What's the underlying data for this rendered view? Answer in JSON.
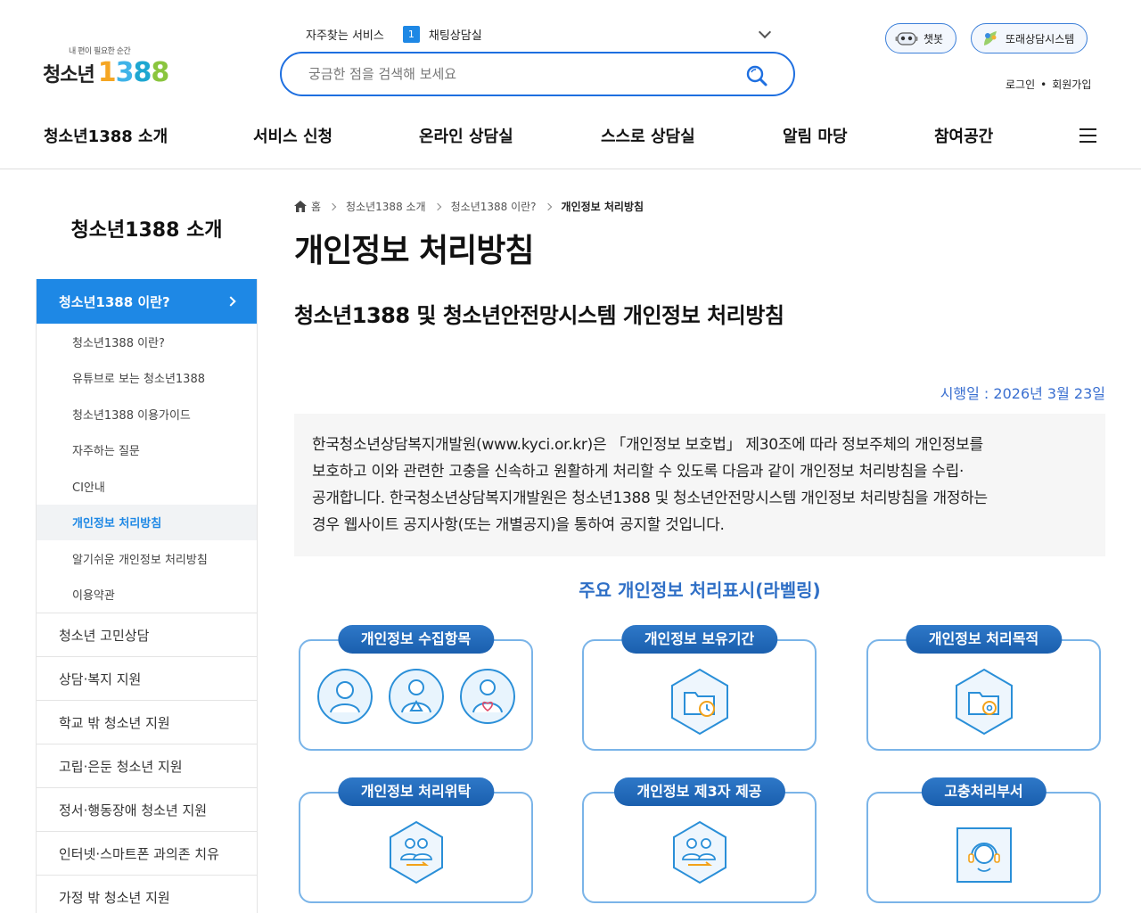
{
  "logo": {
    "tagline": "내 편이 필요한 순간",
    "name": "청소년",
    "number": [
      "1",
      "3",
      "8",
      "8"
    ]
  },
  "frequent": {
    "label": "자주찾는 서비스",
    "rank": "1",
    "item": "채팅상담실"
  },
  "search": {
    "placeholder": "궁금한 점을 검색해 보세요"
  },
  "top_buttons": {
    "chatbot": "챗봇",
    "peer": "또래상담시스템"
  },
  "account": {
    "login": "로그인",
    "sep": "•",
    "join": "회원가입"
  },
  "gnb": [
    "청소년1388 소개",
    "서비스 신청",
    "온라인 상담실",
    "스스로 상담실",
    "알림 마당",
    "참여공간"
  ],
  "sidebar": {
    "title": "청소년1388 소개",
    "active": "청소년1388 이란?",
    "sub_items": [
      "청소년1388 이란?",
      "유튜브로 보는 청소년1388",
      "청소년1388 이용가이드",
      "자주하는 질문",
      "CI안내",
      "개인정보 처리방침",
      "알기쉬운 개인정보 처리방침",
      "이용약관"
    ],
    "current_sub": "개인정보 처리방침",
    "items": [
      "청소년 고민상담",
      "상담·복지 지원",
      "학교 밖 청소년 지원",
      "고립·은둔 청소년 지원",
      "정서·행동장애 청소년 지원",
      "인터넷·스마트폰 과의존 치유",
      "가정 밖 청소년 지원"
    ]
  },
  "breadcrumb": [
    "홈",
    "청소년1388 소개",
    "청소년1388 이란?",
    "개인정보 처리방침"
  ],
  "page_title": "개인정보 처리방침",
  "subtitle": "청소년1388 및 청소년안전망시스템 개인정보 처리방침",
  "effective_date": "시행일 : 2026년 3월 23일",
  "intro_lines": [
    "한국청소년상담복지개발원(www.kyci.or.kr)은 「개인정보 보호법」 제30조에 따라 정보주체의 개인정보를",
    "보호하고 이와 관련한 고충을 신속하고 원활하게 처리할 수 있도록 다음과 같이 개인정보 처리방침을 수립·",
    "공개합니다. 한국청소년상담복지개발원은 청소년1388 및 청소년안전망시스템 개인정보 처리방침을 개정하는",
    "경우 웹사이트 공지사항(또는 개별공지)을 통하여 공지할 것입니다."
  ],
  "labeling_title": "주요 개인정보 처리표시(라벨링)",
  "cards": [
    {
      "label": "개인정보 수집항목",
      "icons": [
        "person-icon",
        "person-triangle-icon",
        "person-heart-icon"
      ]
    },
    {
      "label": "개인정보 보유기간",
      "icons": [
        "folder-clock-icon"
      ]
    },
    {
      "label": "개인정보 처리목적",
      "icons": [
        "folder-gear-icon"
      ]
    },
    {
      "label": "개인정보 처리위탁",
      "icons": [
        "people-transfer-icon"
      ]
    },
    {
      "label": "개인정보 제3자 제공",
      "icons": [
        "people-third-party-icon"
      ]
    },
    {
      "label": "고충처리부서",
      "icons": [
        "headset-icon"
      ]
    }
  ],
  "colors": {
    "primary": "#1e88e5",
    "accent": "#2f6fc6",
    "card_border": "#7ab4e8"
  }
}
